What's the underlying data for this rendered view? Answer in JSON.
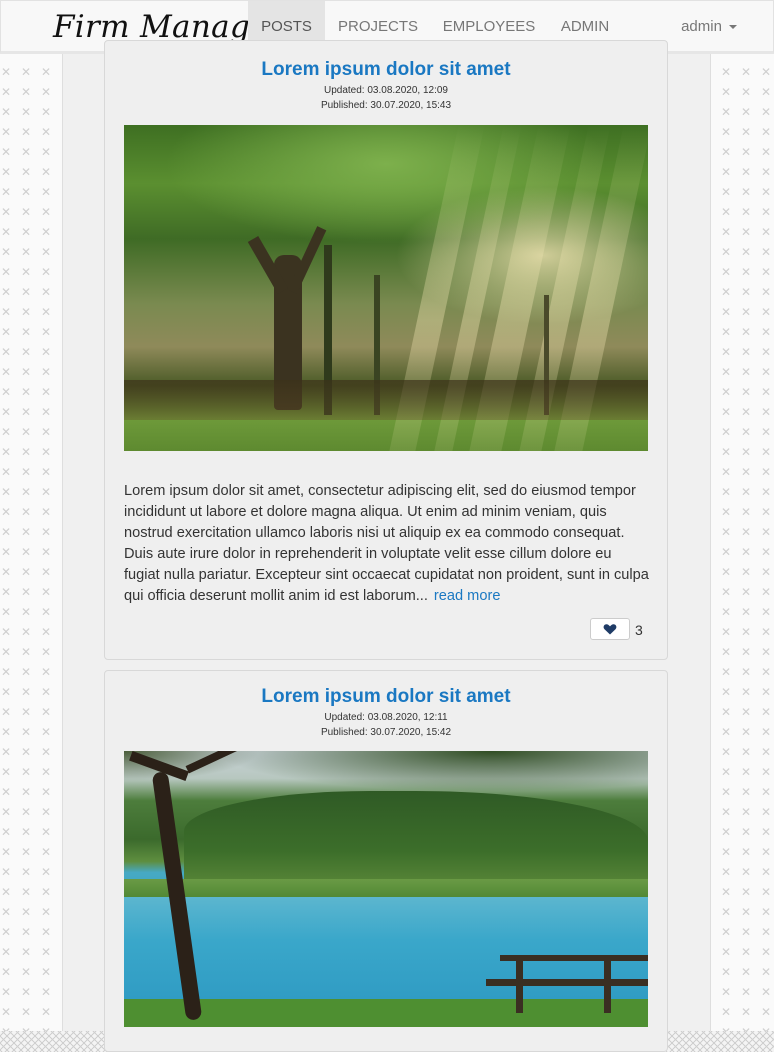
{
  "brand": "Firm Manager",
  "nav": {
    "items": [
      "POSTS",
      "PROJECTS",
      "EMPLOYEES",
      "ADMIN"
    ],
    "active": "POSTS",
    "user": "admin"
  },
  "posts": [
    {
      "title": "Lorem ipsum dolor sit amet",
      "updated": "Updated: 03.08.2020, 12:09",
      "published": "Published: 30.07.2020, 15:43",
      "excerpt": "Lorem ipsum dolor sit amet, consectetur adipiscing elit, sed do eiusmod tempor incididunt ut labore et dolore magna aliqua. Ut enim ad minim veniam, quis nostrud exercitation ullamco laboris nisi ut aliquip ex ea commodo consequat. Duis aute irure dolor in reprehenderit in voluptate velit esse cillum dolore eu fugiat nulla pariatur. Excepteur sint occaecat cupidatat non proident, sunt in culpa qui officia deserunt mollit anim id est laborum...",
      "read_more": "read more",
      "likes": "3",
      "image": "sunlit-forest-photo"
    },
    {
      "title": "Lorem ipsum dolor sit amet",
      "updated": "Updated: 03.08.2020, 12:11",
      "published": "Published: 30.07.2020, 15:42",
      "image": "lake-with-bench-photo"
    }
  ],
  "colors": {
    "link": "#1a78c2",
    "nav_active_bg": "#e4e4e4"
  },
  "icons": [
    "heart-icon",
    "caret-down-icon"
  ]
}
